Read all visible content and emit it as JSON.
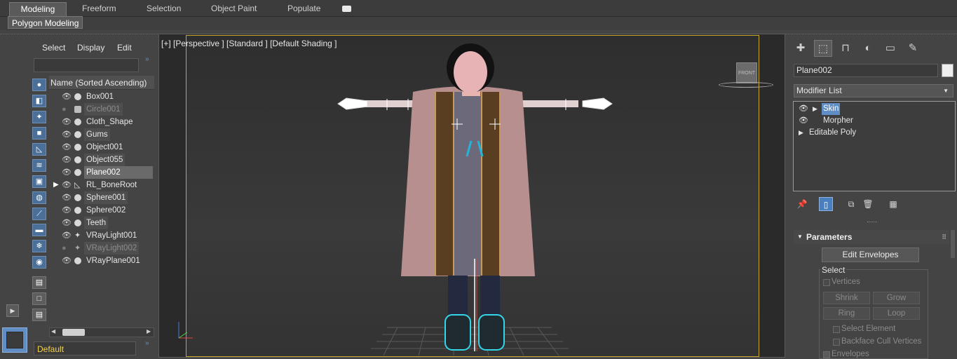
{
  "ribbon": {
    "tabs": [
      "Modeling",
      "Freeform",
      "Selection",
      "Object Paint",
      "Populate"
    ],
    "active_tab": "Modeling",
    "subtab": "Polygon Modeling"
  },
  "scene_explorer": {
    "menu": [
      "Select",
      "Display",
      "Edit"
    ],
    "column_header": "Name (Sorted Ascending)",
    "items": [
      {
        "name": "Box001"
      },
      {
        "name": "Circle001"
      },
      {
        "name": "Cloth_Shape"
      },
      {
        "name": "Gums"
      },
      {
        "name": "Object001"
      },
      {
        "name": "Object055"
      },
      {
        "name": "Plane002"
      },
      {
        "name": "RL_BoneRoot"
      },
      {
        "name": "Sphere001"
      },
      {
        "name": "Sphere002"
      },
      {
        "name": "Teeth"
      },
      {
        "name": "VRayLight001"
      },
      {
        "name": "VRayLight002"
      },
      {
        "name": "VRayPlane001"
      }
    ],
    "layer": "Default"
  },
  "viewport": {
    "label": "[+] [Perspective ] [Standard ] [Default Shading ]",
    "viewcube_face": "FRONT"
  },
  "command_panel": {
    "object_name": "Plane002",
    "modifier_list": "Modifier List",
    "stack": [
      {
        "name": "Skin"
      },
      {
        "name": "Morpher"
      },
      {
        "name": "Editable Poly"
      }
    ],
    "rollout": {
      "title": "Parameters",
      "edit_envelopes": "Edit Envelopes",
      "select_group": "Select",
      "vertices": "Vertices",
      "shrink": "Shrink",
      "grow": "Grow",
      "ring": "Ring",
      "loop": "Loop",
      "select_element": "Select Element",
      "backface_cull": "Backface Cull Vertices",
      "envelopes": "Envelopes"
    }
  },
  "colors": {
    "accent": "#5f8dc4",
    "safe_frame": "#c9a52e",
    "layer_text": "#f2d24b",
    "object_color": "#eeeeee"
  }
}
